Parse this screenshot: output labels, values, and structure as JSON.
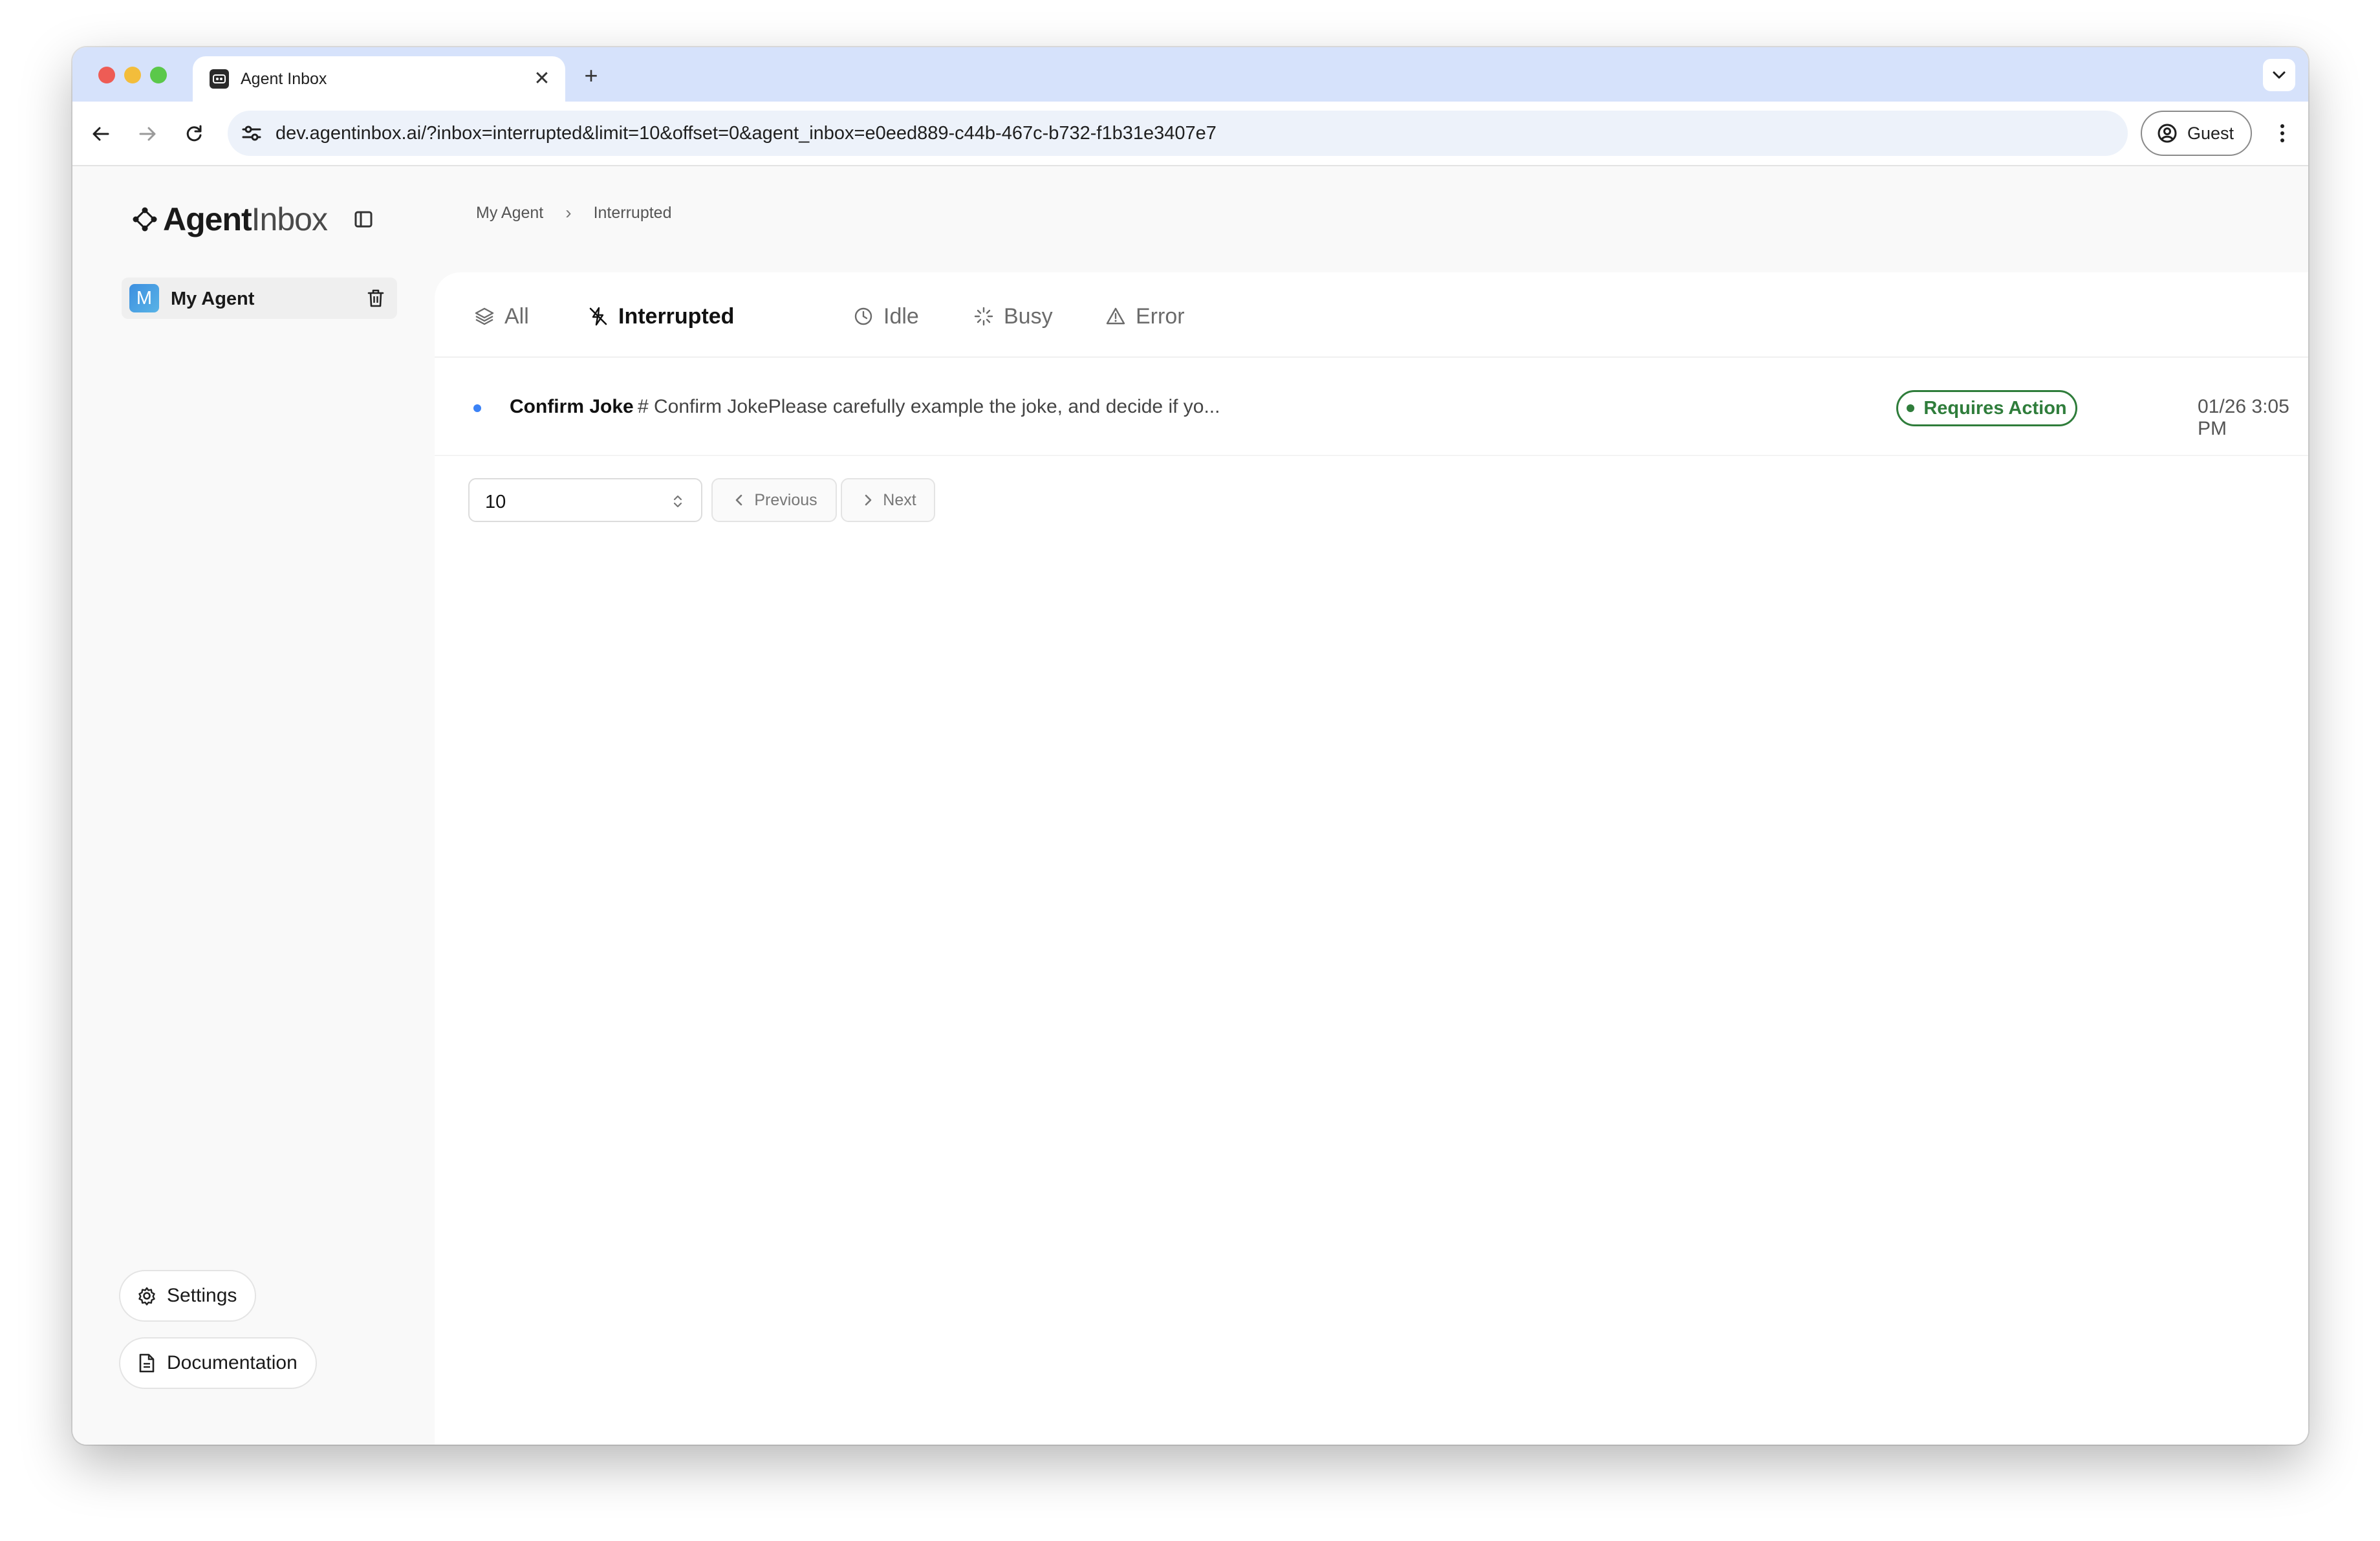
{
  "browser": {
    "tab_title": "Agent Inbox",
    "url": "dev.agentinbox.ai/?inbox=interrupted&limit=10&offset=0&agent_inbox=e0eed889-c44b-467c-b732-f1b31e3407e7",
    "profile_label": "Guest",
    "new_tab_glyph": "+",
    "close_glyph": "✕"
  },
  "sidebar": {
    "logo_primary": "Agent",
    "logo_secondary": "Inbox",
    "agents": [
      {
        "initial": "M",
        "name": "My Agent"
      }
    ],
    "settings_label": "Settings",
    "documentation_label": "Documentation"
  },
  "breadcrumb": {
    "items": [
      "My Agent",
      "Interrupted"
    ],
    "separator": "›"
  },
  "filters": {
    "tabs": [
      {
        "label": "All",
        "icon": "layers-icon",
        "active": false
      },
      {
        "label": "Interrupted",
        "icon": "interrupted-icon",
        "active": true
      },
      {
        "label": "Idle",
        "icon": "clock-icon",
        "active": false
      },
      {
        "label": "Busy",
        "icon": "loader-icon",
        "active": false
      },
      {
        "label": "Error",
        "icon": "warning-icon",
        "active": false
      }
    ]
  },
  "threads": [
    {
      "title": "Confirm Joke",
      "description": "# Confirm JokePlease carefully example the joke, and decide if yo...",
      "status": "Requires Action",
      "timestamp": "01/26 3:05 PM"
    }
  ],
  "pagination": {
    "page_size": "10",
    "previous_label": "Previous",
    "next_label": "Next"
  },
  "colors": {
    "status_badge": "#2f7d3b",
    "unread_dot": "#3b82f6",
    "tab_strip": "#d6e2fb"
  }
}
